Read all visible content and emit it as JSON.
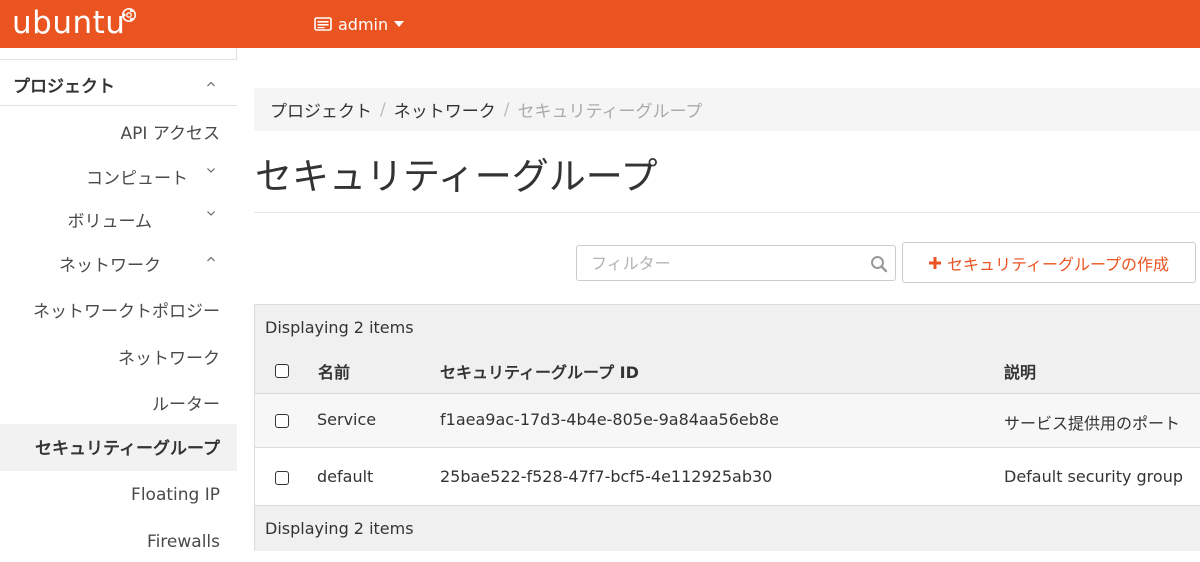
{
  "header": {
    "logo_text": "ubuntu",
    "user": "admin",
    "brand_color": "#e95420"
  },
  "sidebar": {
    "section": "プロジェクト",
    "items": [
      {
        "label": "API アクセス",
        "has_chevron": false
      },
      {
        "label": "コンピュート",
        "has_chevron": true,
        "expanded": false
      },
      {
        "label": "ボリューム",
        "has_chevron": true,
        "expanded": false
      },
      {
        "label": "ネットワーク",
        "has_chevron": true,
        "expanded": true
      },
      {
        "label": "ネットワークトポロジー",
        "has_chevron": false
      },
      {
        "label": "ネットワーク",
        "has_chevron": false
      },
      {
        "label": "ルーター",
        "has_chevron": false
      },
      {
        "label": "セキュリティーグループ",
        "has_chevron": false,
        "active": true
      },
      {
        "label": "Floating IP",
        "has_chevron": false
      },
      {
        "label": "Firewalls",
        "has_chevron": false
      }
    ]
  },
  "breadcrumb": [
    "プロジェクト",
    "ネットワーク",
    "セキュリティーグループ"
  ],
  "page_title": "セキュリティーグループ",
  "filter": {
    "placeholder": "フィルター",
    "value": ""
  },
  "create_button": {
    "icon": "plus-icon",
    "label": "セキュリティーグループの作成"
  },
  "table": {
    "count_text": "Displaying 2 items",
    "columns": [
      "名前",
      "セキュリティーグループ ID",
      "説明"
    ],
    "rows": [
      {
        "name": "Service",
        "id": "f1aea9ac-17d3-4b4e-805e-9a84aa56eb8e",
        "description": "サービス提供用のポート"
      },
      {
        "name": "default",
        "id": "25bae522-f528-47f7-bcf5-4e112925ab30",
        "description": "Default security group"
      }
    ],
    "footer_text": "Displaying 2 items"
  }
}
